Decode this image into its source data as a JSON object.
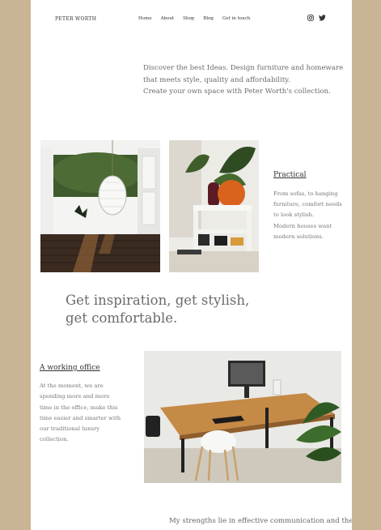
{
  "brand": "PETER WORTH",
  "nav": [
    "Home",
    "About",
    "Shop",
    "Blog",
    "Get in touch"
  ],
  "social": [
    "instagram-icon",
    "twitter-icon"
  ],
  "intro": [
    "Discover the best Ideas. Design furniture and homeware",
    "that meets style, quality and affordability.",
    "Create your own space with Peter Worth's collection."
  ],
  "practical": {
    "title": "Practical",
    "lines": [
      "From sofas, to hanging",
      "furniture, comfort needs",
      "to look stylish.",
      "Modern houses want",
      "modern solutions."
    ]
  },
  "headline": [
    "Get inspiration, get stylish,",
    "get comfortable."
  ],
  "office": {
    "title": "A working office",
    "lines": [
      "At the moment, we are",
      "spending more and more",
      "time in the office, make this",
      "time easier and smarter with",
      "our traditional luxury",
      "collection."
    ]
  },
  "strengths": "My strengths lie in effective communication and the",
  "colors": {
    "background": "#c9b595",
    "page": "#ffffff"
  }
}
